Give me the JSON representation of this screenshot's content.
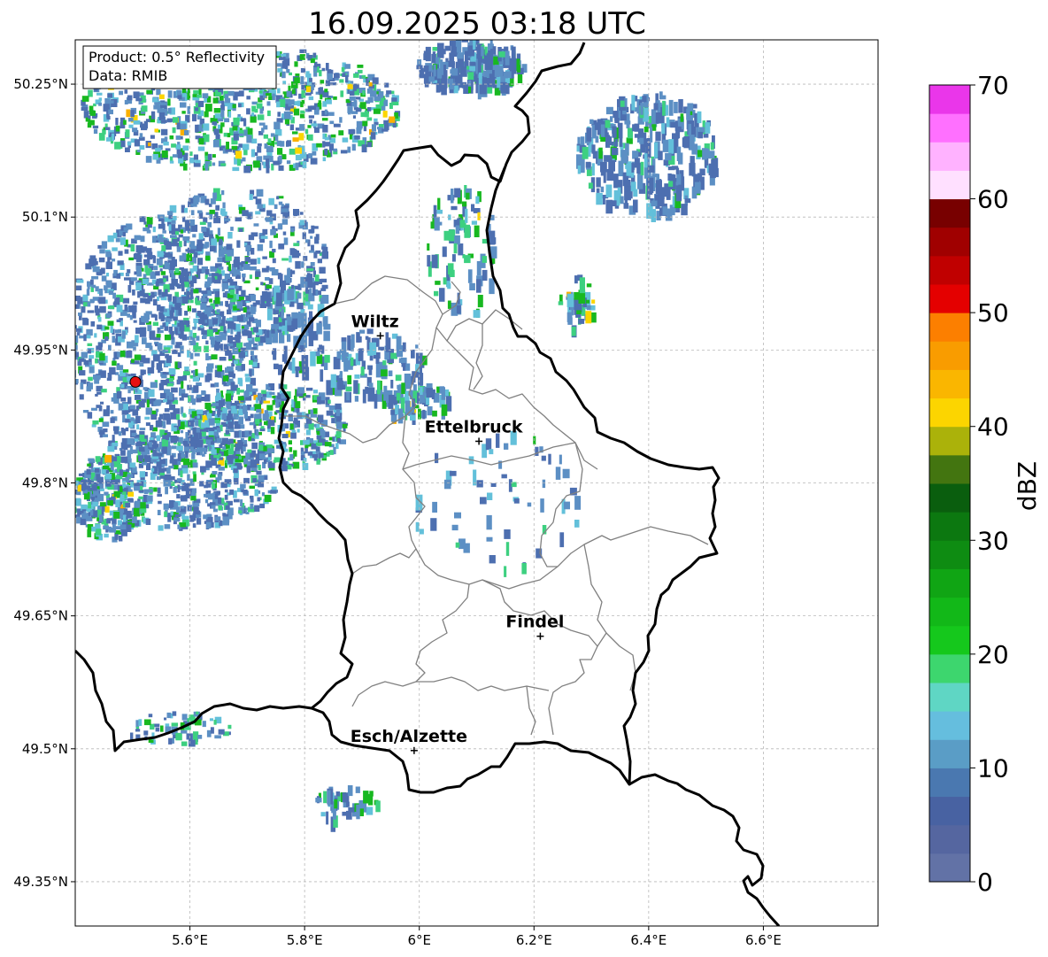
{
  "title": "16.09.2025 03:18 UTC",
  "info_box": {
    "product": "Product: 0.5° Reflectivity",
    "data_source": "Data: RMIB"
  },
  "map": {
    "lon_range": [
      5.4,
      6.8
    ],
    "lat_range": [
      49.3,
      50.3
    ],
    "x_ticks": [
      "5.6°E",
      "5.8°E",
      "6°E",
      "6.2°E",
      "6.4°E",
      "6.6°E"
    ],
    "x_tick_values": [
      5.6,
      5.8,
      6.0,
      6.2,
      6.4,
      6.6
    ],
    "y_ticks": [
      "49.35°N",
      "49.5°N",
      "49.65°N",
      "49.8°N",
      "49.95°N",
      "50.1°N",
      "50.25°N"
    ],
    "y_tick_values": [
      49.35,
      49.5,
      49.65,
      49.8,
      49.95,
      50.1,
      50.25
    ],
    "grid": true,
    "radar_site": {
      "lon": 5.505,
      "lat": 49.914,
      "color": "#e81010"
    },
    "cities": [
      {
        "name": "Wiltz",
        "lon": 5.932,
        "lat": 49.966
      },
      {
        "name": "Ettelbruck",
        "lon": 6.104,
        "lat": 49.847
      },
      {
        "name": "Findel",
        "lon": 6.211,
        "lat": 49.627
      },
      {
        "name": "Esch/Alzette",
        "lon": 5.991,
        "lat": 49.498
      }
    ]
  },
  "colorbar": {
    "label": "dBZ",
    "min": 0,
    "max": 70,
    "step": 2.5,
    "ticks": [
      "0",
      "10",
      "20",
      "30",
      "40",
      "50",
      "60",
      "70"
    ],
    "colors": [
      "#6272a6",
      "#5566a0",
      "#4862a2",
      "#4a78b0",
      "#5a9dc6",
      "#65bede",
      "#5fd6c4",
      "#3dd66e",
      "#15c81c",
      "#12b818",
      "#10a514",
      "#0e8c12",
      "#0c7810",
      "#0a5e0e",
      "#437510",
      "#abb20a",
      "#fcd500",
      "#fab600",
      "#f99c00",
      "#fc7f00",
      "#e40000",
      "#c00000",
      "#a00000",
      "#780000",
      "#ffe0ff",
      "#ffb2ff",
      "#ff70ff",
      "#ea36ea"
    ]
  },
  "echo_colors": [
    "#4d6fb0",
    "#5c8fc4",
    "#63c0da",
    "#3dd080",
    "#18b820",
    "#fcd500",
    "#fab000",
    "#fc7f00"
  ]
}
